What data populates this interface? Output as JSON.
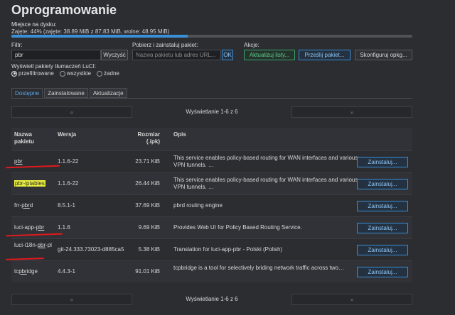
{
  "page": {
    "title": "Oprogramowanie",
    "disk_label": "Miejsce na dysku:",
    "disk_text": "Zajęte: 44% (zajęte: 38.89 MiB z 87.83 MiB, wolne: 48.95 MiB)",
    "disk_used_fraction": 0.44
  },
  "filter": {
    "label": "Filtr:",
    "value": "pbr",
    "clear_label": "Wyczyść"
  },
  "download": {
    "label": "Pobierz i zainstaluj pakiet:",
    "placeholder": "Nazwa pakietu lub adres URL...",
    "ok_label": "OK"
  },
  "actions": {
    "label": "Akcje:",
    "update_label": "Aktualizuj listy...",
    "upload_label": "Prześlij pakiet...",
    "configure_label": "Skonfiguruj opkg..."
  },
  "translations": {
    "label": "Wyświetl pakiety tłumaczeń LuCI:",
    "options": [
      "przefiltrowane",
      "wszystkie",
      "żadne"
    ],
    "selected": "przefiltrowane"
  },
  "tabs": [
    "Dostępne",
    "Zainstalowane",
    "Aktualizacje"
  ],
  "pager": {
    "prev": "«",
    "next": "»",
    "info": "Wyświetlanie 1-6 z 6"
  },
  "table": {
    "headers": {
      "name_line1": "Nazwa",
      "name_line2": "pakietu",
      "version": "Wersja",
      "size_line1": "Rozmiar",
      "size_line2": "(.ipk)",
      "desc": "Opis"
    },
    "install_label": "Zainstaluj...",
    "rows": [
      {
        "pre": "",
        "hl": "pbr",
        "post": "",
        "version": "1.1.6-22",
        "size": "23.71 KiB",
        "desc": "This service enables policy-based routing for WAN interfaces and various VPN tunnels. …"
      },
      {
        "pre": "",
        "hl": "pbr-iptables",
        "post": "",
        "version": "1.1.6-22",
        "size": "26.44 KiB",
        "desc": "This service enables policy-based routing for WAN interfaces and various VPN tunnels. …"
      },
      {
        "pre": "frr-",
        "hl": "pbr",
        "post": "d",
        "version": "8.5.1-1",
        "size": "37.69 KiB",
        "desc": "pbrd routing engine"
      },
      {
        "pre": "luci-app-",
        "hl": "pbr",
        "post": "",
        "version": "1.1.6",
        "size": "9.69 KiB",
        "desc": "Provides Web UI for Policy Based Routing Service."
      },
      {
        "pre": "luci-i18n-",
        "hl": "pbr",
        "post": "-pl",
        "version": "git-24.333.73023-d885ca5",
        "size": "5.38 KiB",
        "desc": "Translation for luci-app-pbr - Polski (Polish)"
      },
      {
        "pre": "tc",
        "hl": "pbr",
        "post": "idge",
        "version": "4.4.3-1",
        "size": "91.01 KiB",
        "desc": "tcpbridge is a tool for selectively briding network traffic across two…"
      }
    ]
  }
}
